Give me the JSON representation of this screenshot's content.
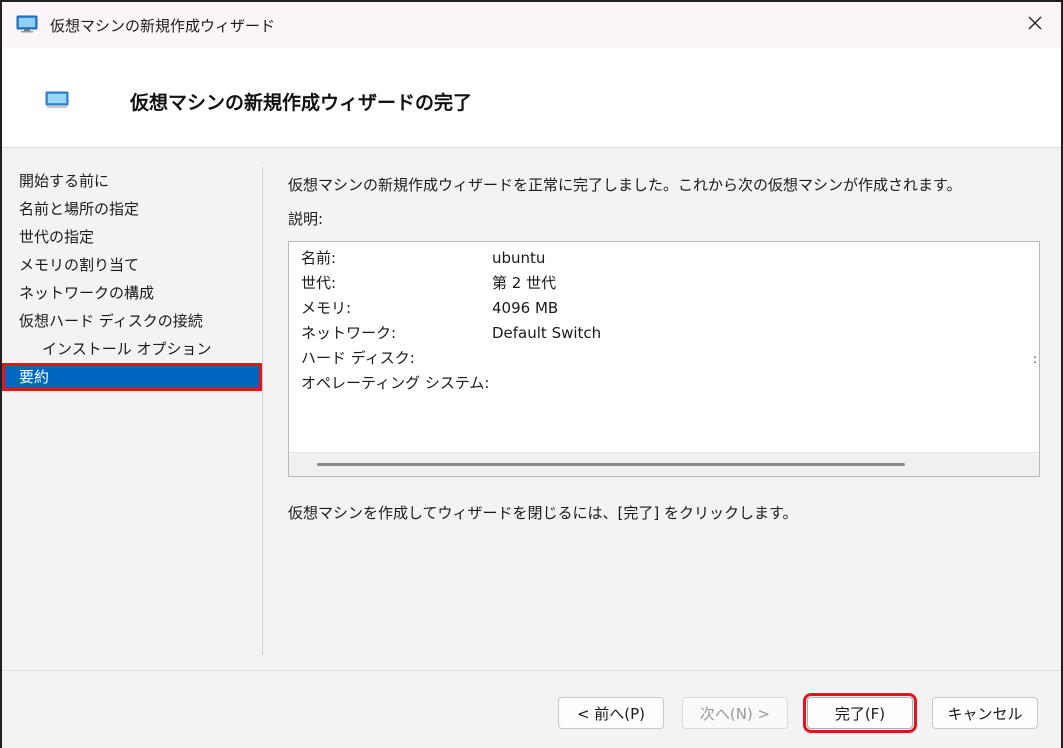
{
  "window": {
    "title": "仮想マシンの新規作成ウィザード"
  },
  "header": {
    "title": "仮想マシンの新規作成ウィザードの完了"
  },
  "nav": {
    "items": [
      {
        "label": "開始する前に"
      },
      {
        "label": "名前と場所の指定"
      },
      {
        "label": "世代の指定"
      },
      {
        "label": "メモリの割り当て"
      },
      {
        "label": "ネットワークの構成"
      },
      {
        "label": "仮想ハード ディスクの接続"
      },
      {
        "label": "インストール オプション"
      },
      {
        "label": "要約"
      }
    ],
    "active_index": 7
  },
  "main": {
    "intro": "仮想マシンの新規作成ウィザードを正常に完了しました。これから次の仮想マシンが作成されます。",
    "description_label": "説明:",
    "summary": [
      {
        "key": "名前:",
        "value": "ubuntu"
      },
      {
        "key": "世代:",
        "value": "第 2 世代"
      },
      {
        "key": "メモリ:",
        "value": "4096 MB"
      },
      {
        "key": "ネットワーク:",
        "value": "Default Switch"
      },
      {
        "key": "ハード ディスク:",
        "value": ""
      },
      {
        "key": "オペレーティング システム:",
        "value": ""
      }
    ],
    "trailing_mark": ":",
    "finish_hint": "仮想マシンを作成してウィザードを閉じるには、[完了] をクリックします。"
  },
  "footer": {
    "prev_label": "< 前へ(P)",
    "next_label": "次へ(N) >",
    "finish_label": "完了(F)",
    "cancel_label": "キャンセル"
  },
  "colors": {
    "accent": "#0067c0",
    "highlight": "#e0161c"
  },
  "icons": {
    "title": "monitor-icon",
    "close": "close-icon",
    "header": "monitor-icon"
  }
}
